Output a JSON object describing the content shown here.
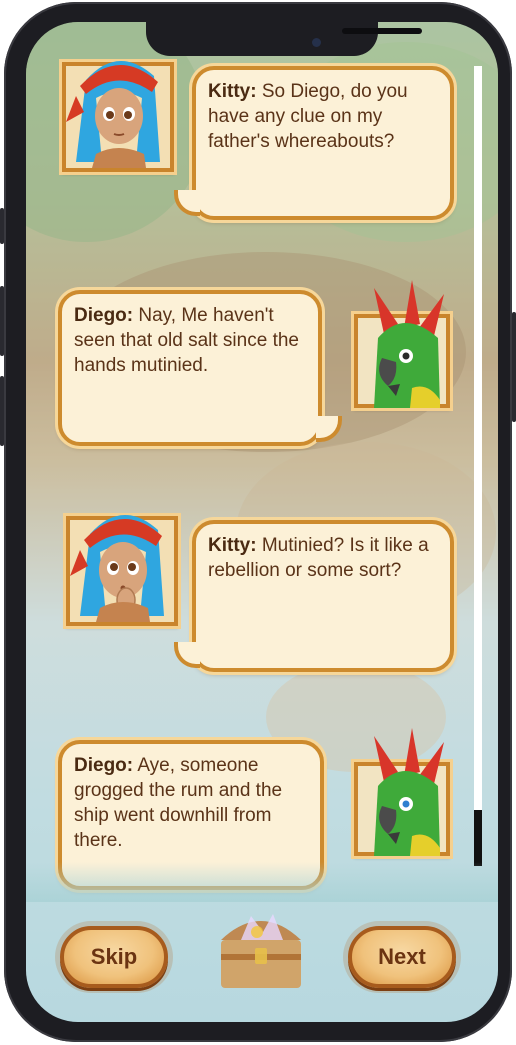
{
  "dialogue": [
    {
      "speaker": "Kitty:",
      "text": "So Diego, do you have any clue on my father's whereabouts?"
    },
    {
      "speaker": "Diego:",
      "text": "Nay, Me haven't seen that old salt since the hands mutinied."
    },
    {
      "speaker": "Kitty:",
      "text": "Mutinied? Is it like a rebellion or some sort?"
    },
    {
      "speaker": "Diego:",
      "text": "Aye, someone grogged the rum and the ship went downhill from there."
    }
  ],
  "buttons": {
    "skip": "Skip",
    "next": "Next"
  },
  "icons": {
    "kitty": "kitty-portrait-icon",
    "diego": "diego-parrot-portrait-icon",
    "chest": "treasure-chest-icon"
  },
  "colors": {
    "bubble_fill": "#fcf1d7",
    "bubble_border": "#cd8b2e",
    "text": "#5a3318",
    "kitty_hair": "#2fa6e0",
    "kitty_bandana": "#d63a24",
    "parrot_green": "#3faa3a"
  }
}
